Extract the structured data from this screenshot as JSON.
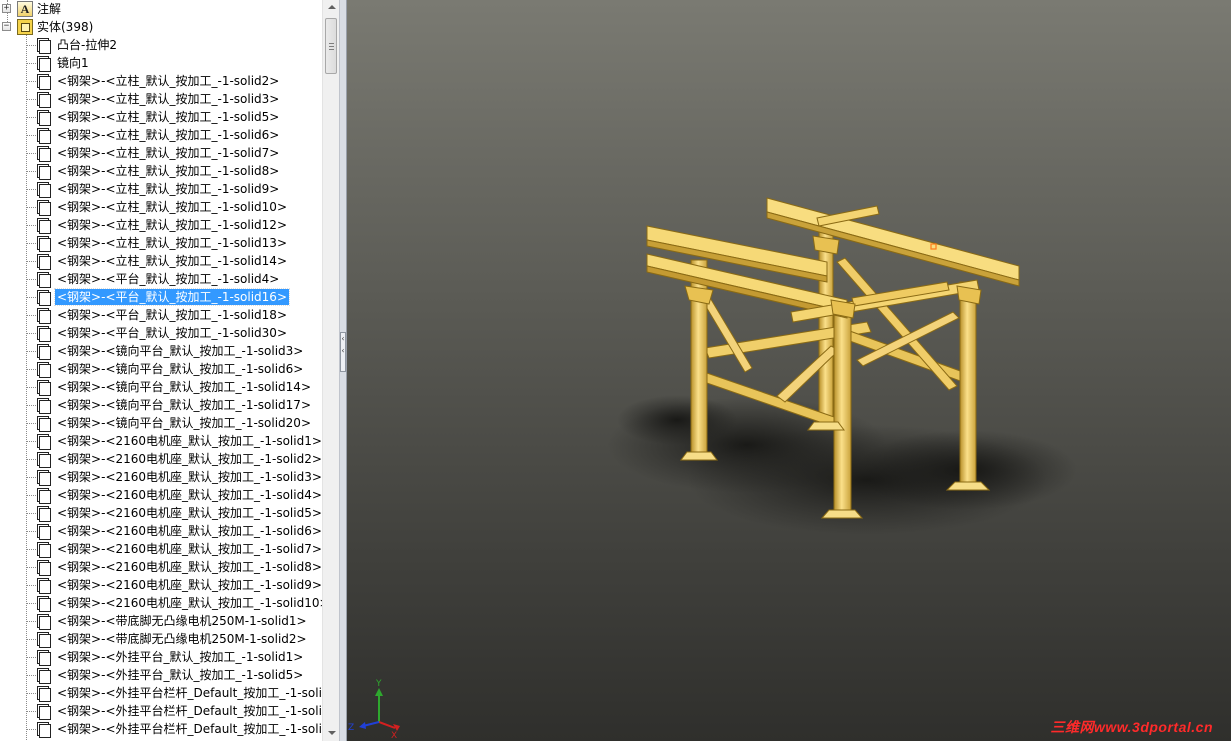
{
  "tree": {
    "annotations_label": "注解",
    "solid_bodies_label": "实体(398)",
    "expander_collapsed": "+",
    "expander_expanded": "−",
    "selected_index": 14,
    "items": [
      "凸台-拉伸2",
      "镜向1",
      "<钢架>-<立柱_默认_按加工_-1-solid2>",
      "<钢架>-<立柱_默认_按加工_-1-solid3>",
      "<钢架>-<立柱_默认_按加工_-1-solid5>",
      "<钢架>-<立柱_默认_按加工_-1-solid6>",
      "<钢架>-<立柱_默认_按加工_-1-solid7>",
      "<钢架>-<立柱_默认_按加工_-1-solid8>",
      "<钢架>-<立柱_默认_按加工_-1-solid9>",
      "<钢架>-<立柱_默认_按加工_-1-solid10>",
      "<钢架>-<立柱_默认_按加工_-1-solid12>",
      "<钢架>-<立柱_默认_按加工_-1-solid13>",
      "<钢架>-<立柱_默认_按加工_-1-solid14>",
      "<钢架>-<平台_默认_按加工_-1-solid4>",
      "<钢架>-<平台_默认_按加工_-1-solid16>",
      "<钢架>-<平台_默认_按加工_-1-solid18>",
      "<钢架>-<平台_默认_按加工_-1-solid30>",
      "<钢架>-<镜向平台_默认_按加工_-1-solid3>",
      "<钢架>-<镜向平台_默认_按加工_-1-solid6>",
      "<钢架>-<镜向平台_默认_按加工_-1-solid14>",
      "<钢架>-<镜向平台_默认_按加工_-1-solid17>",
      "<钢架>-<镜向平台_默认_按加工_-1-solid20>",
      "<钢架>-<2160电机座_默认_按加工_-1-solid1>",
      "<钢架>-<2160电机座_默认_按加工_-1-solid2>",
      "<钢架>-<2160电机座_默认_按加工_-1-solid3>",
      "<钢架>-<2160电机座_默认_按加工_-1-solid4>",
      "<钢架>-<2160电机座_默认_按加工_-1-solid5>",
      "<钢架>-<2160电机座_默认_按加工_-1-solid6>",
      "<钢架>-<2160电机座_默认_按加工_-1-solid7>",
      "<钢架>-<2160电机座_默认_按加工_-1-solid8>",
      "<钢架>-<2160电机座_默认_按加工_-1-solid9>",
      "<钢架>-<2160电机座_默认_按加工_-1-solid10>",
      "<钢架>-<带底脚无凸缘电机250M-1-solid1>",
      "<钢架>-<带底脚无凸缘电机250M-1-solid2>",
      "<钢架>-<外挂平台_默认_按加工_-1-solid1>",
      "<钢架>-<外挂平台_默认_按加工_-1-solid5>",
      "<钢架>-<外挂平台栏杆_Default_按加工_-1-solid",
      "<钢架>-<外挂平台栏杆_Default_按加工_-1-solid",
      "<钢架>-<外挂平台栏杆_Default_按加工_-1-solid"
    ]
  },
  "viewport": {
    "triad_x_label": "X",
    "triad_y_label": "Y",
    "triad_z_label": "Z",
    "watermark": "三维网www.3dportal.cn",
    "model_color": "#f2d06b",
    "model_edge_color": "#9c7a1c"
  },
  "colors": {
    "selection": "#3399ff",
    "viewport_top": "#7a7a72",
    "viewport_bottom": "#2f2f2c"
  }
}
